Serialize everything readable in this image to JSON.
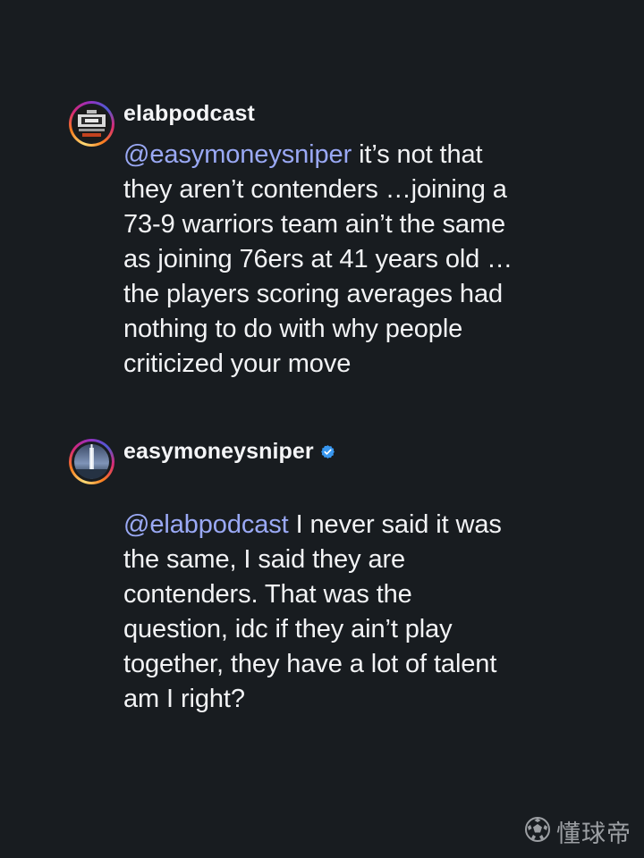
{
  "comments": [
    {
      "username": "elabpodcast",
      "verified": false,
      "mention": "@easymoneysniper",
      "lines": [
        " it’s not that",
        "they aren’t contenders …joining a",
        "73-9 warriors team ain’t the same",
        "as joining 76ers at 41 years old …",
        "the players scoring averages had",
        "nothing to do with why people",
        "criticized your move"
      ]
    },
    {
      "username": "easymoneysniper",
      "verified": true,
      "mention": "@elabpodcast",
      "lines": [
        " I never said it was",
        "the same, I said they are",
        "contenders. That was the",
        "question, idc if they ain’t play",
        "together, they have a lot of talent",
        "am I right?"
      ]
    }
  ],
  "watermark": {
    "text": "懂球帝",
    "icon": "soccer-ball-icon"
  },
  "colors": {
    "background": "#181c20",
    "mention": "#9aa9f5",
    "text": "#f2f3f5",
    "verified": "#3897f0"
  }
}
